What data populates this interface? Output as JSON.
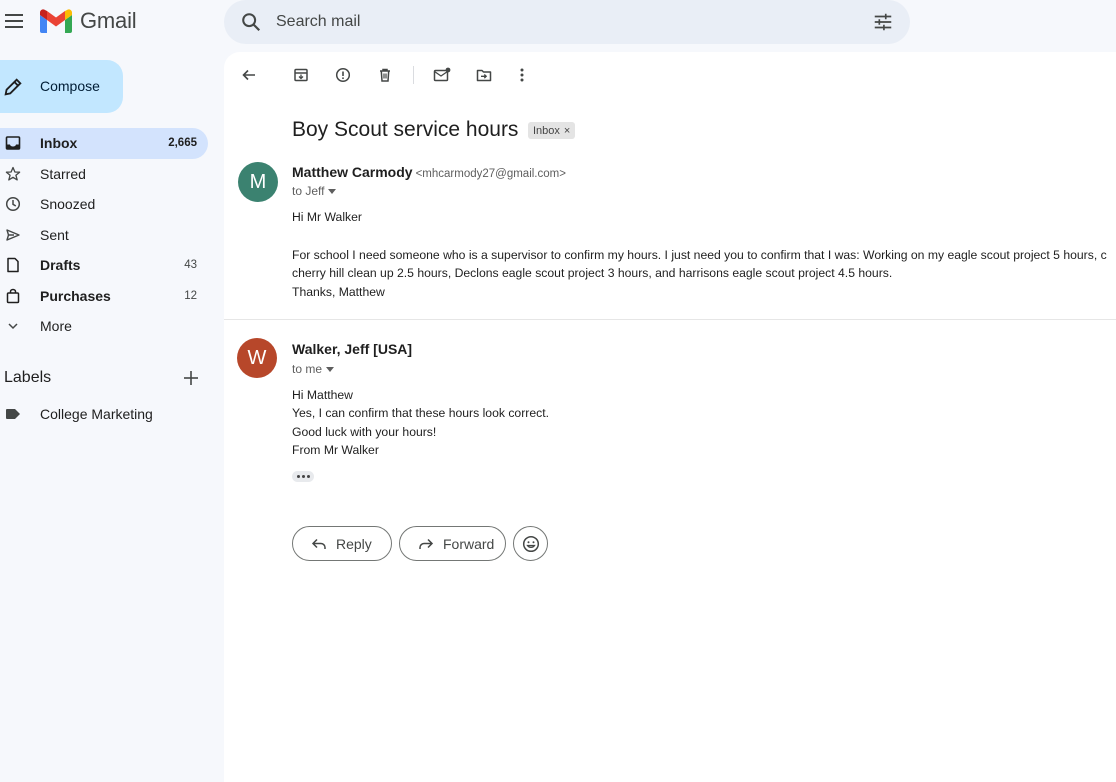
{
  "app": {
    "name": "Gmail"
  },
  "search": {
    "placeholder": "Search mail"
  },
  "sidebar": {
    "compose_label": "Compose",
    "items": [
      {
        "label": "Inbox",
        "count": "2,665",
        "icon": "inbox-icon"
      },
      {
        "label": "Starred",
        "count": "",
        "icon": "star-icon"
      },
      {
        "label": "Snoozed",
        "count": "",
        "icon": "clock-icon"
      },
      {
        "label": "Sent",
        "count": "",
        "icon": "send-icon"
      },
      {
        "label": "Drafts",
        "count": "43",
        "icon": "draft-icon"
      },
      {
        "label": "Purchases",
        "count": "12",
        "icon": "bag-icon"
      },
      {
        "label": "More",
        "count": "",
        "icon": "chevron-down-icon"
      }
    ],
    "labels_heading": "Labels",
    "labels": [
      {
        "label": "College Marketing",
        "icon": "label-icon"
      }
    ]
  },
  "thread": {
    "subject": "Boy Scout service hours",
    "chip": "Inbox",
    "messages": [
      {
        "avatar_letter": "M",
        "avatar_color": "#3b8270",
        "sender": "Matthew Carmody",
        "email": "<mhcarmody27@gmail.com>",
        "to": "to Jeff",
        "lines": [
          "Hi Mr Walker",
          "For school I need someone who is a supervisor to confirm my hours. I just need you to confirm that I was: Working on my eagle scout project 5 hours, c",
          "cherry hill clean up 2.5 hours, Declons eagle scout project 3 hours, and harrisons eagle scout project 4.5 hours.",
          "Thanks, Matthew"
        ]
      },
      {
        "avatar_letter": "W",
        "avatar_color": "#b7472a",
        "sender": "Walker, Jeff [USA]",
        "email": "",
        "to": "to me",
        "lines": [
          "Hi Matthew",
          "Yes, I can confirm that these hours look correct.",
          "Good luck with your hours!",
          "From Mr Walker"
        ]
      }
    ],
    "reply_label": "Reply",
    "forward_label": "Forward"
  }
}
